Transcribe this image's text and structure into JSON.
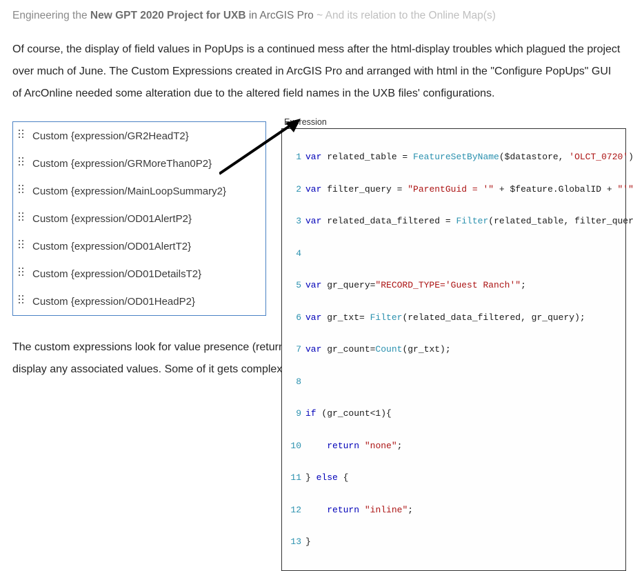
{
  "heading": {
    "prefix": "Engineering the ",
    "bold": "New GPT 2020 Project for UXB",
    "mid": " in ArcGIS Pro ",
    "tilde": "~ ",
    "tail": "And its relation to the Online Map(s)"
  },
  "intro": "Of course, the display of field values in PopUps is a continued mess after the html-display troubles which plagued the project over much of June.  The Custom Expressions created in ArcGIS Pro and arranged with html in the \"Configure PopUps\" GUI of ArcOnline needed some alteration due to the altered field names in the UXB files' configurations.",
  "expressions": [
    "Custom {expression/GR2HeadT2}",
    "Custom {expression/GRMoreThan0P2}",
    "Custom {expression/MainLoopSummary2}",
    "Custom {expression/OD01AlertP2}",
    "Custom {expression/OD01AlertT2}",
    "Custom {expression/OD01DetailsT2}",
    "Custom {expression/OD01HeadP2}"
  ],
  "code_header": "Expression",
  "code": {
    "l1": {
      "kw": "var",
      "rest1": " related_table = ",
      "fn": "FeatureSetByName",
      "rest2": "($datastore, ",
      "str": "'OLCT_0720'",
      "rest3": ");"
    },
    "l2": {
      "kw": "var",
      "rest1": " filter_query = ",
      "str1": "\"ParentGuid = '\"",
      "plus1": " + $feature.GlobalID + ",
      "str2": "\"'\"",
      "tail": ";"
    },
    "l3": {
      "kw": "var",
      "rest1": " related_data_filtered = ",
      "fn": "Filter",
      "rest2": "(related_table, filter_query);"
    },
    "l5": {
      "kw": "var",
      "rest1": " gr_query=",
      "str": "\"RECORD_TYPE='Guest Ranch'\"",
      "tail": ";"
    },
    "l6": {
      "kw": "var",
      "rest1": " gr_txt= ",
      "fn": "Filter",
      "rest2": "(related_data_filtered, gr_query);"
    },
    "l7": {
      "kw": "var",
      "rest1": " gr_count=",
      "fn": "Count",
      "rest2": "(gr_txt);"
    },
    "l9": {
      "kw": "if",
      "rest": " (gr_count<1){"
    },
    "l10": {
      "indent": "    ",
      "kw": "return",
      "sp": " ",
      "str": "\"none\"",
      "tail": ";"
    },
    "l11": {
      "close": "} ",
      "kw": "else",
      "open": " {"
    },
    "l12": {
      "indent": "    ",
      "kw": "return",
      "sp": " ",
      "str": "\"inline\"",
      "tail": ";"
    },
    "l13": {
      "close": "}"
    }
  },
  "line_numbers": [
    "1",
    "2",
    "3",
    "4",
    "5",
    "6",
    "7",
    "8",
    "9",
    "10",
    "11",
    "12",
    "13"
  ],
  "outro": "The custom expressions look for value presence (return \"inline\" if found, and \"none\" if not), then use the returned info to display any associated values.  Some of it gets complex.  A good text editor is your friend."
}
